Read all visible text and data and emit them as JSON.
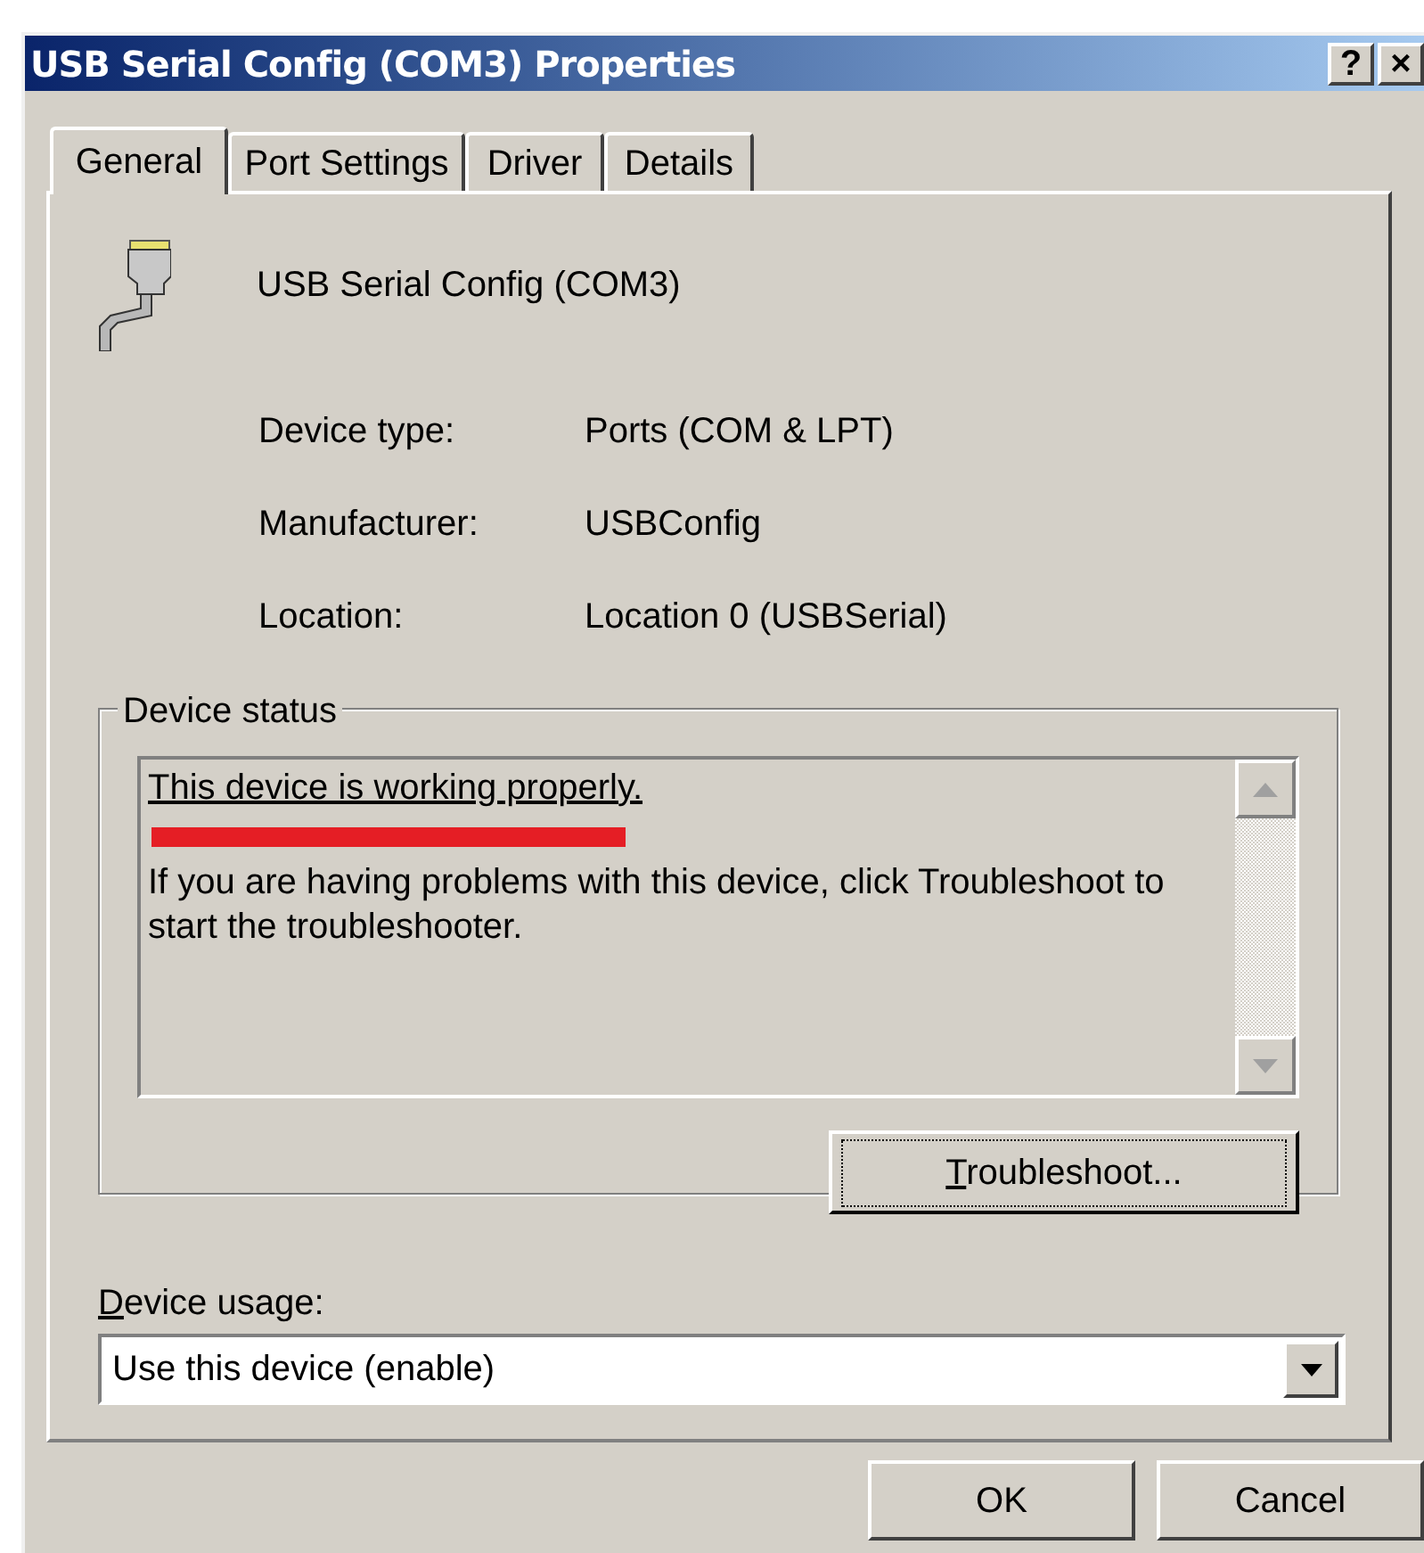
{
  "window": {
    "title": "USB Serial Config (COM3) Properties",
    "title_buttons": [
      "?",
      "×"
    ]
  },
  "tabs": [
    {
      "label": "General",
      "selected": true
    },
    {
      "label": "Port Settings",
      "selected": false
    },
    {
      "label": "Driver",
      "selected": false
    },
    {
      "label": "Details",
      "selected": false
    }
  ],
  "device": {
    "name": "USB Serial Config (COM3)"
  },
  "properties": [
    {
      "label": "Device type:",
      "value": "Ports (COM & LPT)"
    },
    {
      "label": "Manufacturer:",
      "value": "USBConfig"
    },
    {
      "label": "Location:",
      "value": "Location 0 (USBSerial)"
    }
  ],
  "device_status": {
    "title": "Device status",
    "messages": [
      {
        "text": "This device is working properly.",
        "highlighted": true
      },
      {
        "text": "If you are having problems with this device, click Troubleshoot to start the troubleshooter.",
        "highlighted": false
      }
    ],
    "button": {
      "label": "Troubleshoot...",
      "mnemonic_underlined": true,
      "focused": true
    }
  },
  "device_usage": {
    "label": "Device usage:",
    "mnemonic_underlined": true,
    "value": "Use this device (enable)"
  },
  "buttons": [
    {
      "label": "OK"
    },
    {
      "label": "Cancel"
    }
  ]
}
